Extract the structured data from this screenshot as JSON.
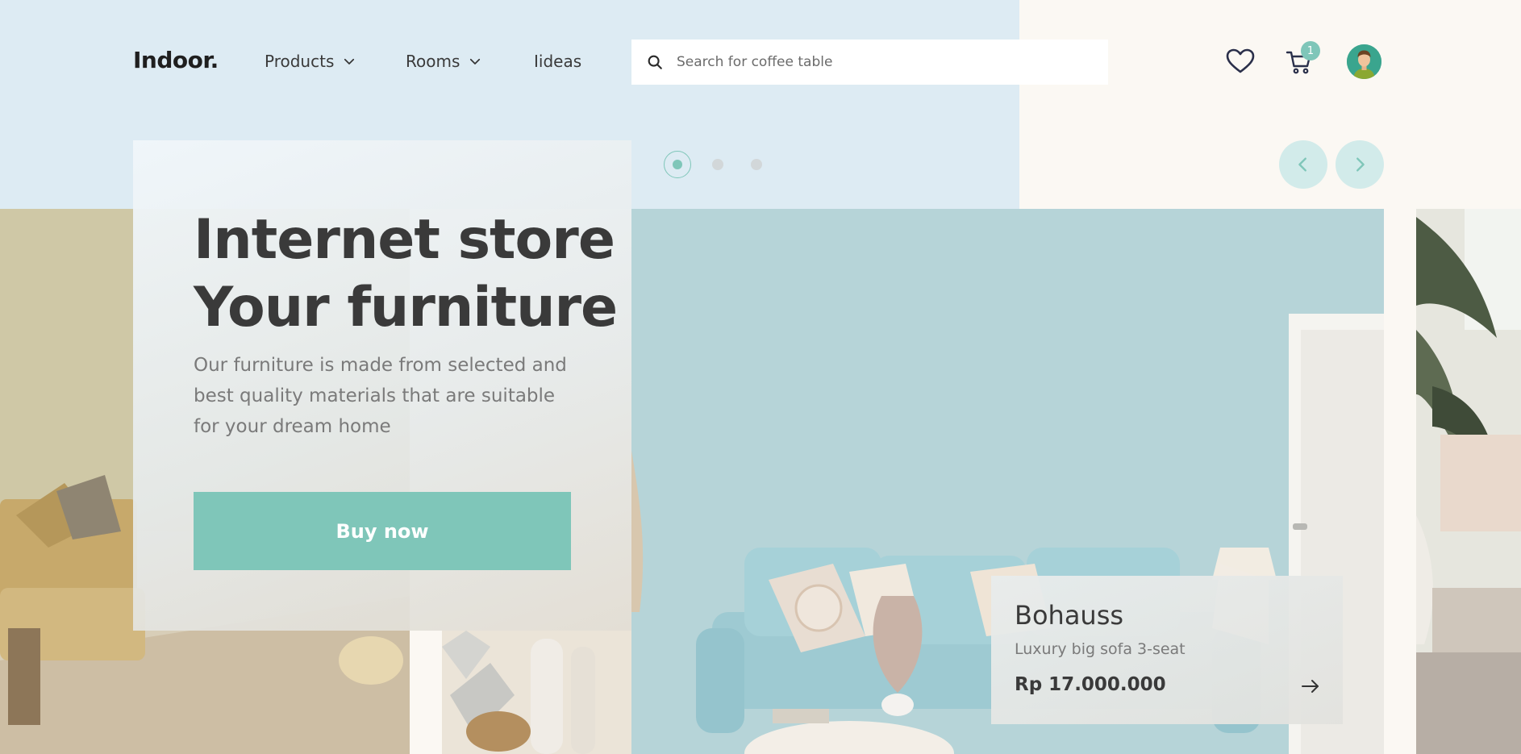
{
  "header": {
    "logo": "Indoor.",
    "nav": [
      {
        "label": "Products",
        "has_dropdown": true
      },
      {
        "label": "Rooms",
        "has_dropdown": true
      },
      {
        "label": "Iideas",
        "has_dropdown": false
      }
    ],
    "search": {
      "placeholder": "Search for coffee table",
      "icon": "search-icon"
    },
    "wishlist_icon": "heart-icon",
    "cart": {
      "icon": "cart-icon",
      "count": "1"
    },
    "avatar_icon": "avatar"
  },
  "carousel": {
    "dots": 3,
    "active_index": 0,
    "prev_icon": "chevron-left-icon",
    "next_icon": "chevron-right-icon"
  },
  "hero": {
    "title_line1": "Internet store",
    "title_line2": "Your furniture",
    "description": "Our furniture is made from selected and best quality materials that are suitable for your dream home",
    "cta_label": "Buy now"
  },
  "product": {
    "name": "Bohauss",
    "subtitle": "Luxury big sofa 3-seat",
    "price": "Rp 17.000.000",
    "arrow_icon": "arrow-right-icon"
  },
  "colors": {
    "accent": "#7fc6b9",
    "header_bg": "#ddebf3",
    "cream": "#fbf8f3",
    "text_dark": "#3a3a3a"
  }
}
